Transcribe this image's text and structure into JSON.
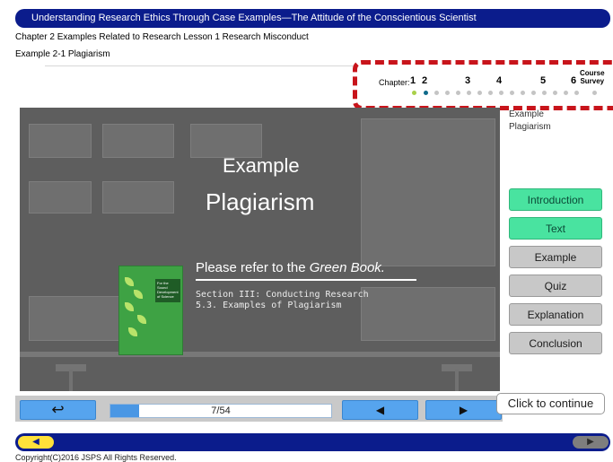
{
  "header": {
    "title": "Understanding Research Ethics Through Case Examples—The Attitude of the Conscientious Scientist",
    "chapter_line": "Chapter 2 Examples Related to Research Lesson 1 Research Misconduct",
    "example_line": "Example 2-1 Plagiarism"
  },
  "progress": {
    "chapter_label": "Chapter:",
    "chapters": [
      "1",
      "2",
      "3",
      "4",
      "5",
      "6"
    ],
    "survey_line1": "Course",
    "survey_line2": "Survey",
    "dot_colors": {
      "visited": "#a9d04a",
      "current": "#0f6a8a",
      "unvisited": "#c4c4c4"
    }
  },
  "slide": {
    "heading1": "Example",
    "heading2": "Plagiarism",
    "refer_text": "Please refer to the ",
    "refer_book": "Green Book.",
    "section_line1": "Section III: Conducting Research",
    "section_line2": "5.3. Examples of Plagiarism",
    "book_title": "For the Sound Development of Science"
  },
  "sidebar": {
    "caption1": "Example",
    "caption2": "Plagiarism",
    "buttons": [
      {
        "label": "Introduction",
        "state": "visited"
      },
      {
        "label": "Text",
        "state": "visited"
      },
      {
        "label": "Example",
        "state": "default"
      },
      {
        "label": "Quiz",
        "state": "default"
      },
      {
        "label": "Explanation",
        "state": "default"
      },
      {
        "label": "Conclusion",
        "state": "default"
      }
    ]
  },
  "controls": {
    "back_icon": "↩",
    "page_indicator": "7/54",
    "page_progress": 0.13,
    "prev_icon": "◀",
    "next_icon": "▶",
    "tooltip": "Click to continue"
  },
  "footer": {
    "prev_icon": "◀",
    "next_icon": "▶",
    "copyright": "Copyright(C)2016 JSPS All Rights Reserved."
  },
  "colors": {
    "brand": "#0b1c8c",
    "accent_green": "#49e3a0",
    "accent_blue": "#56a4ee",
    "highlight_red": "#c8141b"
  }
}
